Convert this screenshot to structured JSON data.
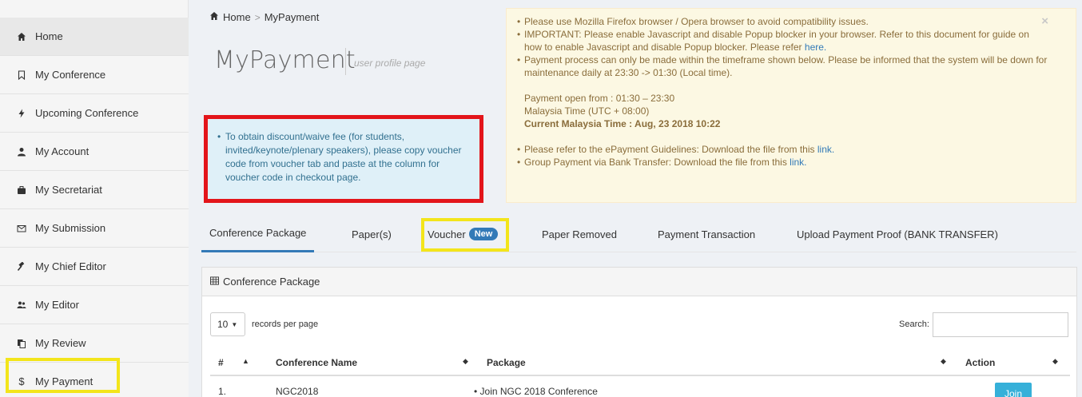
{
  "sidebar": {
    "items": [
      {
        "label": "Home",
        "icon": "home-icon"
      },
      {
        "label": "My Conference",
        "icon": "bookmark-icon"
      },
      {
        "label": "Upcoming Conference",
        "icon": "bolt-icon"
      },
      {
        "label": "My Account",
        "icon": "user-icon"
      },
      {
        "label": "My Secretariat",
        "icon": "briefcase-icon"
      },
      {
        "label": "My Submission",
        "icon": "envelope-icon"
      },
      {
        "label": "My Chief Editor",
        "icon": "gavel-icon"
      },
      {
        "label": "My Editor",
        "icon": "users-icon"
      },
      {
        "label": "My Review",
        "icon": "copy-icon"
      },
      {
        "label": "My Payment",
        "icon": "dollar-icon"
      }
    ]
  },
  "breadcrumb": {
    "home": "Home",
    "sep": ">",
    "current": "MyPayment"
  },
  "page": {
    "title": "MyPayment",
    "subtitle": "user profile page"
  },
  "info_note": "To obtain discount/waive fee (for students, invited/keynote/plenary speakers), please copy voucher code from voucher tab and paste at the column for voucher code in checkout page.",
  "warning": {
    "close": "×",
    "line1": "Please use Mozilla Firefox browser / Opera browser to avoid compatibility issues.",
    "line2": "IMPORTANT: Please enable Javascript and disable Popup blocker in your browser. Refer to this document for guide on how to enable Javascript and disable Popup blocker. Please refer",
    "line2_link": "here.",
    "line3": "Payment process can only be made within the timeframe shown below. Please be informed that the system will be down for maintenance daily at 23:30 -> 01:30 (Local time).",
    "open_from": "Payment open from : 01:30 – 23:30",
    "timezone": "Malaysia Time (UTC + 08:00)",
    "current_time": "Current Malaysia Time : Aug, 23 2018 10:22",
    "guideline": "Please refer to the ePayment Guidelines: Download the file from this",
    "guideline_link": "link.",
    "group": "Group Payment via Bank Transfer: Download the file from this",
    "group_link": "link."
  },
  "tabs": [
    {
      "label": "Conference Package"
    },
    {
      "label": "Paper(s)"
    },
    {
      "label": "Voucher",
      "badge": "New"
    },
    {
      "label": "Paper Removed"
    },
    {
      "label": "Payment Transaction"
    },
    {
      "label": "Upload Payment Proof (BANK TRANSFER)"
    }
  ],
  "panel": {
    "title": "Conference Package",
    "length_value": "10",
    "length_label": "records per page",
    "search_label": "Search:",
    "columns": [
      "#",
      "Conference Name",
      "Package",
      "Action"
    ],
    "rows": [
      {
        "num": "1.",
        "name": "NGC2018",
        "package": "Join NGC 2018 Conference",
        "action": "Join"
      }
    ]
  }
}
